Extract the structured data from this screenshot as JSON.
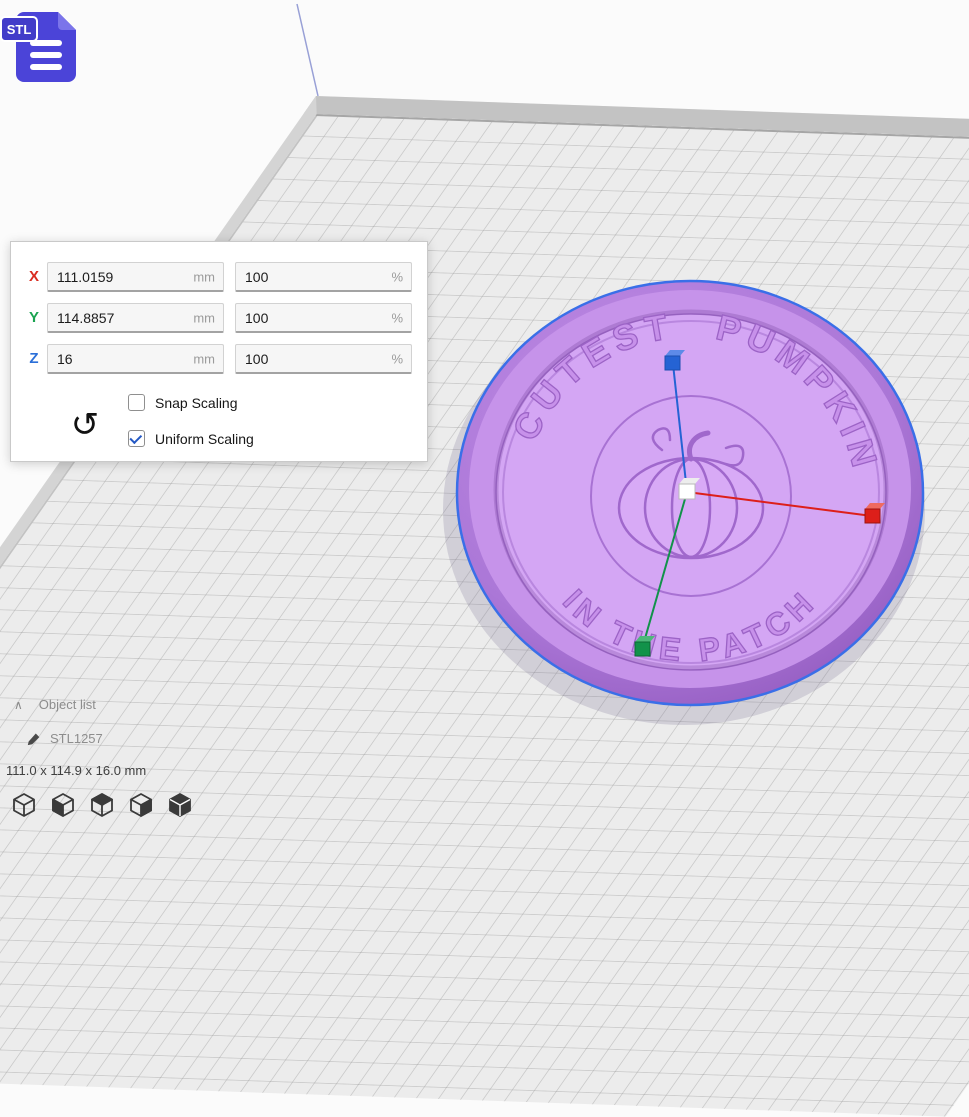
{
  "colors": {
    "axis_x": "#d92b1f",
    "axis_y": "#1aa350",
    "axis_z": "#2b6fd8",
    "handle_x": "#dd1f1a",
    "handle_y": "#12924a",
    "handle_z": "#2563d4",
    "selection_outline": "#3a6fe8",
    "file_icon_blue": "#4b44d8"
  },
  "file_icon": {
    "badge": "STL"
  },
  "scale_panel": {
    "rows": [
      {
        "axis": "X",
        "value": "111.0159",
        "unit": "mm",
        "percent": "100",
        "percent_unit": "%"
      },
      {
        "axis": "Y",
        "value": "114.8857",
        "unit": "mm",
        "percent": "100",
        "percent_unit": "%"
      },
      {
        "axis": "Z",
        "value": "16",
        "unit": "mm",
        "percent": "100",
        "percent_unit": "%"
      }
    ],
    "reset_glyph": "↺",
    "snap": {
      "label": "Snap Scaling",
      "checked": false
    },
    "uniform": {
      "label": "Uniform Scaling",
      "checked": true
    }
  },
  "model": {
    "arc_text_left": "CUTEST",
    "arc_text_right": "PUMPKIN",
    "arc_text_bottom": "IN THE PATCH"
  },
  "object_list": {
    "collapse_glyph": "∧",
    "header": "Object list",
    "item_name": "STL1257",
    "dimensions": "111.0 x 114.9 x 16.0 mm"
  }
}
